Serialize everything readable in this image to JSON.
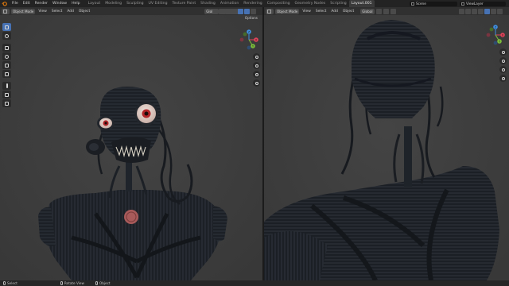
{
  "menu": [
    "File",
    "Edit",
    "Render",
    "Window",
    "Help"
  ],
  "workspace_tabs": [
    {
      "label": "Layout",
      "active": false
    },
    {
      "label": "Modeling",
      "active": false
    },
    {
      "label": "Sculpting",
      "active": false
    },
    {
      "label": "UV Editing",
      "active": false
    },
    {
      "label": "Texture Paint",
      "active": false
    },
    {
      "label": "Shading",
      "active": false
    },
    {
      "label": "Animation",
      "active": false
    },
    {
      "label": "Rendering",
      "active": false
    },
    {
      "label": "Compositing",
      "active": false
    },
    {
      "label": "Geometry Nodes",
      "active": false
    },
    {
      "label": "Scripting",
      "active": false
    },
    {
      "label": "Layout.001",
      "active": true
    }
  ],
  "scene_field": "Scene",
  "viewlayer_field": "ViewLayer",
  "viewport_left": {
    "mode": "Object Mode",
    "menus": [
      "View",
      "Select",
      "Add",
      "Object"
    ],
    "transform": "Global",
    "options_label": "Options"
  },
  "viewport_right": {
    "mode": "Object Mode",
    "menus": [
      "View",
      "Select",
      "Add",
      "Object"
    ],
    "transform": "Global"
  },
  "gizmo_axes": {
    "x": "X",
    "y": "Y",
    "z": "Z"
  },
  "colors": {
    "x_axis": "#e0435a",
    "y_axis": "#7cbf3a",
    "z_axis": "#3f8fe0",
    "accent": "#4772b3"
  },
  "status": [
    "Select",
    "Rotate View",
    "Object"
  ]
}
